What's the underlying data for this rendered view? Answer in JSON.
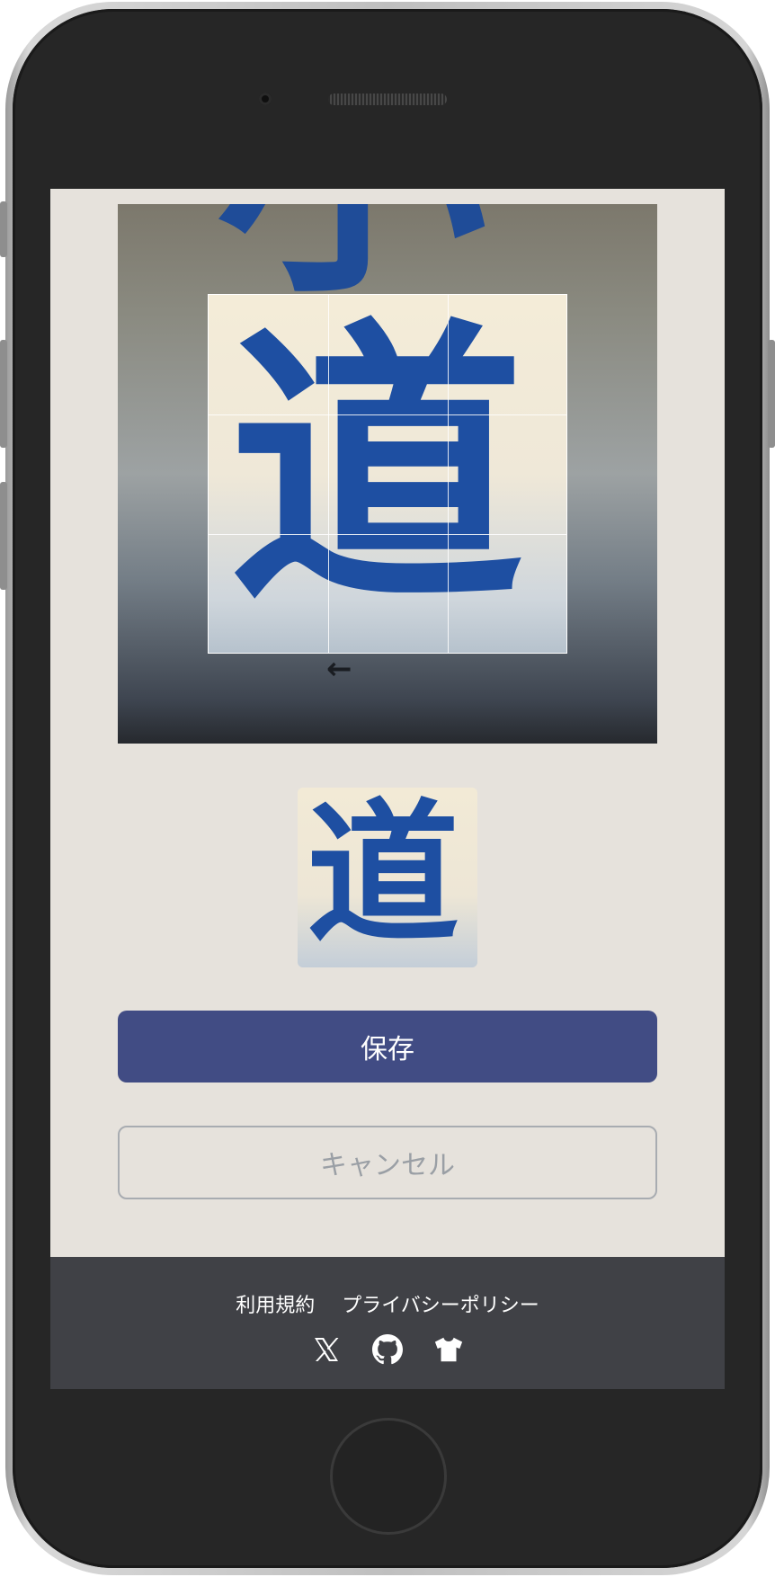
{
  "image_editor": {
    "crop_image_alt": "小道",
    "preview_image_alt": "道",
    "save_label": "保存",
    "cancel_label": "キャンセル"
  },
  "footer": {
    "terms_label": "利用規約",
    "privacy_label": "プライバシーポリシー",
    "icons": [
      "x-logo-icon",
      "github-icon",
      "tshirt-icon"
    ]
  },
  "colors": {
    "screen_background": "#e6e2dc",
    "save_button": "#414c84",
    "footer_background": "#404146",
    "sign_text": "#1e4fa2"
  }
}
